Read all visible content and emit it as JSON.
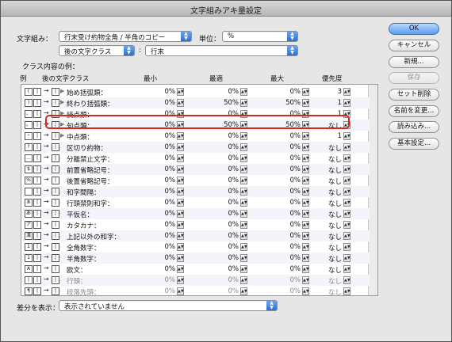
{
  "window": {
    "title": "文字組みアキ量設定"
  },
  "top": {
    "mojigumi_label": "文字組み：",
    "mojigumi_value": "行末受け約物全角 / 半角のコピー",
    "unit_label": "単位：",
    "unit_value": "%",
    "after_class_value": "後の文字クラス",
    "line_end_value": "行末"
  },
  "class_example_label": "クラス内容の例：",
  "columns": {
    "example": "例",
    "after_class": "後の文字クラス",
    "min": "最小",
    "opt": "最適",
    "max": "最大",
    "priority": "優先度"
  },
  "rows": [
    {
      "name": "始め括弧類：",
      "icon": "(",
      "min": "0%",
      "opt": "0%",
      "max": "0%",
      "priority": "3",
      "expand": true
    },
    {
      "name": "終わり括弧類：",
      "icon": ")",
      "min": "0%",
      "opt": "50%",
      "max": "50%",
      "priority": "1",
      "expand": true
    },
    {
      "name": "読点類：",
      "icon": "、",
      "min": "0%",
      "opt": "0%",
      "max": "0%",
      "priority": "1",
      "expand": true
    },
    {
      "name": "句点類：",
      "icon": "。",
      "min": "0%",
      "opt": "50%",
      "max": "50%",
      "priority": "なし",
      "expand": true
    },
    {
      "name": "中点類：",
      "icon": "・",
      "min": "0%",
      "opt": "0%",
      "max": "0%",
      "priority": "1",
      "expand": true
    },
    {
      "name": "区切り約物：",
      "icon": "?",
      "min": "0%",
      "opt": "0%",
      "max": "0%",
      "priority": "なし",
      "expand": false
    },
    {
      "name": "分離禁止文字：",
      "icon": "…",
      "min": "0%",
      "opt": "0%",
      "max": "0%",
      "priority": "なし",
      "expand": false
    },
    {
      "name": "前置省略記号：",
      "icon": "$",
      "min": "0%",
      "opt": "0%",
      "max": "0%",
      "priority": "なし",
      "expand": false
    },
    {
      "name": "後置省略記号：",
      "icon": "%",
      "min": "0%",
      "opt": "0%",
      "max": "0%",
      "priority": "なし",
      "expand": false
    },
    {
      "name": "和字間隔：",
      "icon": " ",
      "min": "0%",
      "opt": "0%",
      "max": "0%",
      "priority": "なし",
      "expand": false
    },
    {
      "name": "行頭禁則和字：",
      "icon": "ぁ",
      "min": "0%",
      "opt": "0%",
      "max": "0%",
      "priority": "なし",
      "expand": false
    },
    {
      "name": "平仮名：",
      "icon": "あ",
      "min": "0%",
      "opt": "0%",
      "max": "0%",
      "priority": "なし",
      "expand": false
    },
    {
      "name": "カタカナ：",
      "icon": "ア",
      "min": "0%",
      "opt": "0%",
      "max": "0%",
      "priority": "なし",
      "expand": false
    },
    {
      "name": "上記以外の和字：",
      "icon": "漢",
      "min": "0%",
      "opt": "0%",
      "max": "0%",
      "priority": "なし",
      "expand": false
    },
    {
      "name": "全角数字：",
      "icon": "1",
      "min": "0%",
      "opt": "0%",
      "max": "0%",
      "priority": "なし",
      "expand": false
    },
    {
      "name": "半角数字：",
      "icon": "1",
      "min": "0%",
      "opt": "0%",
      "max": "0%",
      "priority": "なし",
      "expand": false
    },
    {
      "name": "欧文：",
      "icon": "A",
      "min": "0%",
      "opt": "0%",
      "max": "0%",
      "priority": "なし",
      "expand": false
    },
    {
      "name": "行頭：",
      "icon": "|",
      "min": "0%",
      "opt": "0%",
      "max": "0%",
      "priority": "なし",
      "expand": false,
      "dim": true
    },
    {
      "name": "段落先頭：",
      "icon": "¶",
      "min": "0%",
      "opt": "0%",
      "max": "0%",
      "priority": "なし",
      "expand": false,
      "dim": true
    }
  ],
  "buttons": {
    "ok": "OK",
    "cancel": "キャンセル",
    "new": "新規...",
    "save": "保存",
    "delete_set": "セット削除",
    "rename": "名前を変更...",
    "import": "読み込み...",
    "basic": "基本設定..."
  },
  "bottom": {
    "diff_label": "差分を表示：",
    "diff_value": "表示されていません"
  }
}
